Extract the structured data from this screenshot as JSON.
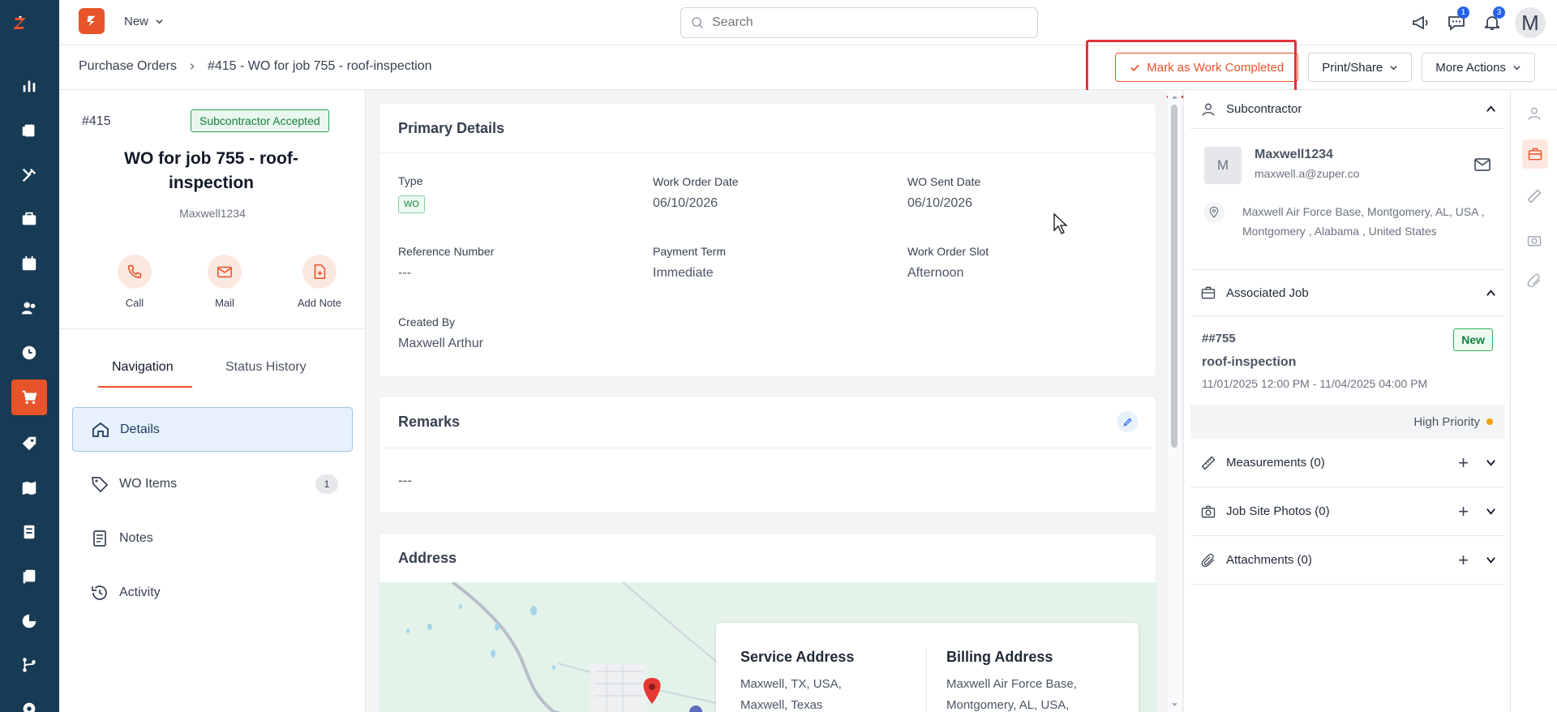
{
  "topbar": {
    "new_label": "New",
    "search_placeholder": "Search",
    "chat_badge": "1",
    "notif_badge": "3",
    "avatar_letter": "M"
  },
  "breadcrumb": {
    "parent": "Purchase Orders",
    "current": "#415 - WO for job 755 - roof-inspection"
  },
  "actions": {
    "mark_completed": "Mark as Work Completed",
    "print_share": "Print/Share",
    "more_actions": "More Actions"
  },
  "summary": {
    "number": "#415",
    "status": "Subcontractor Accepted",
    "title": "WO for job 755 - roof-inspection",
    "subcontractor": "Maxwell1234",
    "quick_actions": [
      {
        "label": "Call",
        "icon": "phone-icon"
      },
      {
        "label": "Mail",
        "icon": "mail-icon"
      },
      {
        "label": "Add Note",
        "icon": "add-note-icon"
      }
    ]
  },
  "tabs": {
    "navigation": "Navigation",
    "status_history": "Status History"
  },
  "nav": [
    {
      "label": "Details",
      "icon": "home-icon",
      "active": true
    },
    {
      "label": "WO Items",
      "icon": "tag-icon",
      "count": "1"
    },
    {
      "label": "Notes",
      "icon": "notes-icon"
    },
    {
      "label": "Activity",
      "icon": "history-icon"
    }
  ],
  "primary": {
    "heading": "Primary Details",
    "type_label": "Type",
    "type_value": "WO",
    "wo_date_label": "Work Order Date",
    "wo_date_value": "06/10/2026",
    "sent_date_label": "WO Sent Date",
    "sent_date_value": "06/10/2026",
    "ref_label": "Reference Number",
    "ref_value": "---",
    "payment_label": "Payment Term",
    "payment_value": "Immediate",
    "slot_label": "Work Order Slot",
    "slot_value": "Afternoon",
    "created_label": "Created By",
    "created_value": "Maxwell Arthur"
  },
  "remarks": {
    "heading": "Remarks",
    "value": "---"
  },
  "address": {
    "heading": "Address",
    "service_heading": "Service Address",
    "service_lines": [
      "Maxwell, TX, USA,",
      "Maxwell, Texas"
    ],
    "billing_heading": "Billing Address",
    "billing_lines": [
      "Maxwell Air Force Base,",
      "Montgomery, AL, USA,"
    ]
  },
  "subcontractor_panel": {
    "heading": "Subcontractor",
    "avatar_letter": "M",
    "name": "Maxwell1234",
    "email": "maxwell.a@zuper.co",
    "address": "Maxwell Air Force Base, Montgomery, AL, USA , Montgomery , Alabama , United States"
  },
  "job_panel": {
    "heading": "Associated Job",
    "job_number": "##755",
    "status": "New",
    "job_name": "roof-inspection",
    "schedule": "11/01/2025 12:00 PM - 11/04/2025 04:00 PM",
    "priority": "High Priority"
  },
  "sections": [
    {
      "label": "Measurements (0)",
      "icon": "ruler-icon"
    },
    {
      "label": "Job Site Photos (0)",
      "icon": "camera-icon"
    },
    {
      "label": "Attachments (0)",
      "icon": "paperclip-icon"
    }
  ],
  "colors": {
    "brand": "#e8542a",
    "rail": "#173a55",
    "success": "#15803d",
    "highlight": "#e5323b"
  }
}
